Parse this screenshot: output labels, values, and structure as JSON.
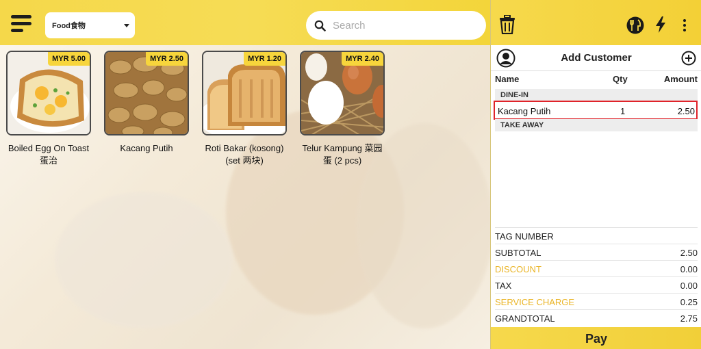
{
  "left_panel": {
    "category_select": {
      "value": "Food食物"
    },
    "search": {
      "placeholder": "Search"
    },
    "products": [
      {
        "name": "Boiled Egg On Toast蛋治",
        "price": "MYR 5.00"
      },
      {
        "name": "Kacang Putih",
        "price": "MYR 2.50"
      },
      {
        "name": "Roti Bakar (kosong) (set 两块)",
        "price": "MYR 1.20"
      },
      {
        "name": "Telur Kampung 菜园蛋  (2 pcs)",
        "price": "MYR 2.40"
      }
    ]
  },
  "right_panel": {
    "customer": {
      "label": "Add Customer"
    },
    "order_table": {
      "headers": {
        "name": "Name",
        "qty": "Qty",
        "amount": "Amount"
      },
      "sections": {
        "dine_in": "DINE-IN",
        "take_away": "TAKE AWAY"
      },
      "lines": [
        {
          "name": "Kacang Putih",
          "qty": "1",
          "amount": "2.50"
        }
      ]
    },
    "totals": [
      {
        "label": "TAG NUMBER",
        "value": ""
      },
      {
        "label": "SUBTOTAL",
        "value": "2.50"
      },
      {
        "label": "DISCOUNT",
        "value": "0.00"
      },
      {
        "label": "TAX",
        "value": "0.00"
      },
      {
        "label": "SERVICE CHARGE",
        "value": "0.25"
      },
      {
        "label": "GRANDTOTAL",
        "value": "2.75"
      }
    ],
    "pay_label": "Pay"
  },
  "colors": {
    "accent": "#f5d84a",
    "highlight_border": "#e0232a",
    "link_accent": "#eab424"
  }
}
